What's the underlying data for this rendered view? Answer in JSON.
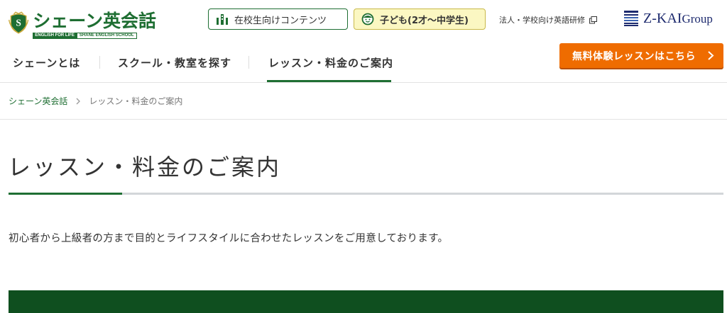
{
  "header": {
    "logo": {
      "name": "シェーン英会話",
      "tagline_left": "ENGLISH FOR LIFE",
      "tagline_right": "SHANE ENGLISH SCHOOL",
      "emblem_letter": "S"
    },
    "students_button": {
      "label": "在校生向けコンテンツ",
      "icon": "building-icon"
    },
    "kids_button": {
      "label": "子ども(2才〜中学生)",
      "icon": "child-face-icon"
    },
    "corporate_link": {
      "label": "法人・学校向け英語研修",
      "icon": "external-link-icon"
    },
    "group_logo": {
      "main": "Z-KAI",
      "suffix": "Group"
    }
  },
  "nav": {
    "items": [
      {
        "label": "シェーンとは"
      },
      {
        "label": "スクール・教室を探す"
      },
      {
        "label": "レッスン・料金のご案内"
      }
    ],
    "active_index": 2,
    "cta": {
      "label": "無料体験レッスンはこちら",
      "icon": "chevron-right-icon"
    }
  },
  "breadcrumb": {
    "home": "シェーン英会話",
    "current": "レッスン・料金のご案内"
  },
  "main": {
    "title": "レッスン・料金のご案内",
    "intro": "初心者から上級者の方まで目的とライフスタイルに合わせたレッスンをご用意しております。"
  },
  "colors": {
    "brand_green": "#1e6e32",
    "dark_green": "#0f4f1f",
    "cta_orange": "#ef6c00",
    "kids_yellow": "#fbf7c2",
    "zkai_navy": "#1d2a6e"
  }
}
